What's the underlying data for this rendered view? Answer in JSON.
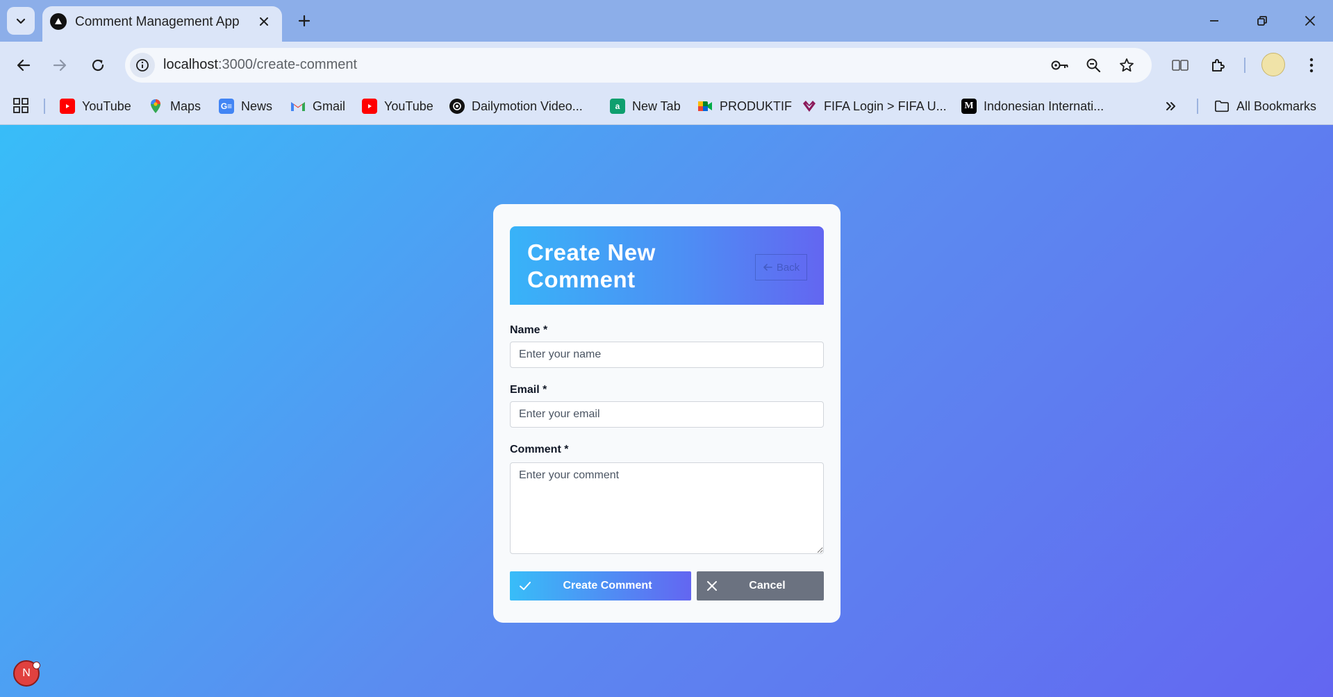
{
  "browser": {
    "tab_title": "Comment Management App",
    "url_host": "localhost",
    "url_path": ":3000/create-comment"
  },
  "bookmarks": {
    "items": [
      {
        "label": "YouTube",
        "icon": "youtube-icon"
      },
      {
        "label": "Maps",
        "icon": "maps-icon"
      },
      {
        "label": "News",
        "icon": "news-icon"
      },
      {
        "label": "Gmail",
        "icon": "gmail-icon"
      },
      {
        "label": "YouTube",
        "icon": "youtube-icon"
      },
      {
        "label": "Dailymotion Video...",
        "icon": "dailymotion-icon"
      },
      {
        "label": "New Tab",
        "icon": "new-tab-icon"
      },
      {
        "label": "PRODUKTIF",
        "icon": "meet-icon"
      },
      {
        "label": "FIFA Login > FIFA U...",
        "icon": "fifa-icon"
      },
      {
        "label": "Indonesian Internati...",
        "icon": "medium-icon"
      }
    ],
    "all_bookmarks": "All Bookmarks"
  },
  "form": {
    "title": "Create New Comment",
    "back_label": "Back",
    "name_label": "Name *",
    "name_placeholder": "Enter your name",
    "email_label": "Email *",
    "email_placeholder": "Enter your email",
    "comment_label": "Comment *",
    "comment_placeholder": "Enter your comment",
    "submit_label": "Create Comment",
    "cancel_label": "Cancel"
  },
  "dev_badge": "N",
  "colors": {
    "page_gradient_start": "#38bdf8",
    "page_gradient_end": "#6366f1",
    "cancel_gray": "#6b7280"
  }
}
